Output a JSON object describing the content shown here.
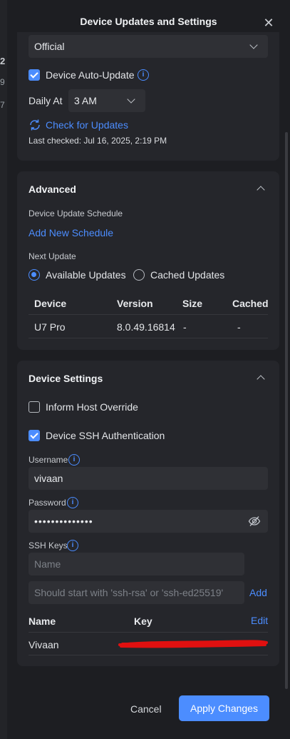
{
  "background": {
    "fragments": [
      "2",
      "9",
      "7"
    ]
  },
  "dialog": {
    "title": "Device Updates and Settings",
    "close_icon": "close-icon"
  },
  "general": {
    "channel_value": "Official",
    "auto_update_label": "Device Auto-Update",
    "auto_update_checked": true,
    "daily_at_label": "Daily At",
    "daily_at_value": "3 AM",
    "check_updates_label": "Check for Updates",
    "last_checked": "Last checked: Jul 16, 2025, 2:19 PM"
  },
  "advanced": {
    "title": "Advanced",
    "schedule_label": "Device Update Schedule",
    "add_schedule_label": "Add New Schedule",
    "next_update_label": "Next Update",
    "options": [
      {
        "label": "Available Updates",
        "selected": true
      },
      {
        "label": "Cached Updates",
        "selected": false
      }
    ],
    "table": {
      "headers": [
        "Device",
        "Version",
        "Size",
        "Cached"
      ],
      "rows": [
        [
          "U7 Pro",
          "8.0.49.16814",
          "-",
          "-"
        ]
      ]
    }
  },
  "device_settings": {
    "title": "Device Settings",
    "inform_host_label": "Inform Host Override",
    "inform_host_checked": false,
    "ssh_auth_label": "Device SSH Authentication",
    "ssh_auth_checked": true,
    "username_label": "Username",
    "username_value": "vivaan",
    "password_label": "Password",
    "password_value": "••••••••••••••",
    "ssh_keys_label": "SSH Keys",
    "name_placeholder": "Name",
    "key_placeholder": "Should start with 'ssh-rsa' or 'ssh-ed25519'",
    "add_label": "Add",
    "keys_table": {
      "headers": [
        "Name",
        "Key"
      ],
      "edit_label": "Edit",
      "rows": [
        {
          "name": "Vivaan"
        }
      ]
    }
  },
  "footer": {
    "cancel_label": "Cancel",
    "apply_label": "Apply Changes"
  },
  "colors": {
    "accent": "#4c8dff",
    "redaction": "#e01010"
  }
}
